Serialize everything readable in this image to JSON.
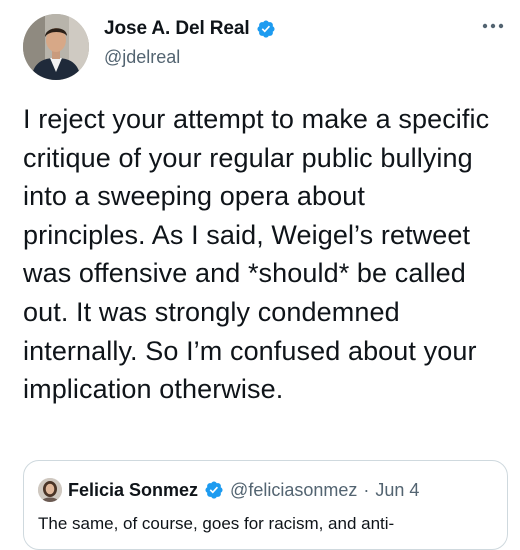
{
  "author": {
    "name": "Jose A. Del Real",
    "handle": "@jdelreal",
    "verified": true,
    "avatar_icon": "profile-photo"
  },
  "tweet": {
    "text": "I reject your attempt to make a specific critique of your regular public bullying into a sweeping opera about principles. As I said, Weigel’s retweet was offensive and *should* be called out. It was strongly condemned internally. So I’m confused about your implication otherwise."
  },
  "quoted_tweet": {
    "name": "Felicia Sonmez",
    "handle": "@feliciasonmez",
    "separator": "·",
    "date": "Jun 4",
    "verified": true,
    "text_partial": "The same, of course, goes for racism, and anti-"
  },
  "colors": {
    "verified_blue": "#1d9bf0",
    "text_primary": "#0f1419",
    "text_secondary": "#536471",
    "border": "#cfd9de"
  }
}
